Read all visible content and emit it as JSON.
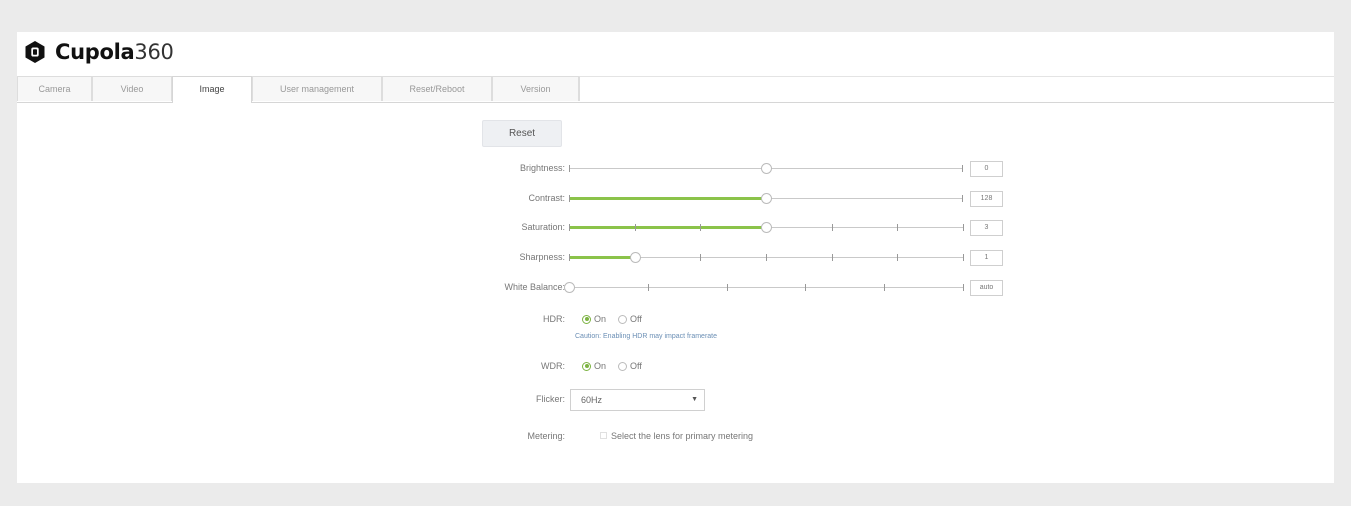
{
  "brand": {
    "name": "Cupola",
    "suffix": "360",
    "logo_icon": "cupola-logo-icon"
  },
  "tabs": [
    {
      "label": "Camera",
      "active": false
    },
    {
      "label": "Video",
      "active": false
    },
    {
      "label": "Image",
      "active": true
    },
    {
      "label": "User management",
      "active": false
    },
    {
      "label": "Reset/Reboot",
      "active": false
    },
    {
      "label": "Version",
      "active": false
    }
  ],
  "reset": {
    "label": "Reset"
  },
  "sliders": {
    "brightness": {
      "label": "Brightness:",
      "value": "0",
      "position": 0.5
    },
    "contrast": {
      "label": "Contrast:",
      "value": "128",
      "position": 0.5
    },
    "saturation": {
      "label": "Saturation:",
      "value": "3",
      "position": 0.5
    },
    "sharpness": {
      "label": "Sharpness:",
      "value": "1",
      "position": 0.167
    },
    "white_balance": {
      "label": "White Balance:",
      "value": "auto",
      "position": 0.0
    }
  },
  "hdr": {
    "label": "HDR:",
    "on_label": "On",
    "off_label": "Off",
    "selected": "On",
    "caution": "Caution: Enabling HDR may impact framerate"
  },
  "wdr": {
    "label": "WDR:",
    "on_label": "On",
    "off_label": "Off",
    "selected": "On"
  },
  "flicker": {
    "label": "Flicker:",
    "value": "60Hz"
  },
  "metering": {
    "label": "Metering:",
    "checkbox_label": "Select the lens for primary metering"
  },
  "colors": {
    "accent_green": "#8bc34a",
    "caution_text": "#6b8fb5"
  }
}
